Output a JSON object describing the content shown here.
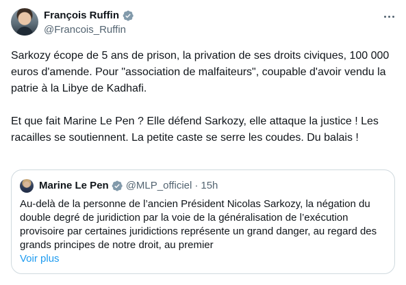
{
  "author": {
    "name": "François Ruffin",
    "handle": "@Francois_Ruffin",
    "verified": true,
    "verified_color": "#829aab"
  },
  "tweet": {
    "paragraphs": [
      "Sarkozy écope de 5 ans de prison, la privation de ses droits civiques, 100 000 euros d'amende. Pour \"association de malfaiteurs\", coupable d'avoir vendu la patrie à la Libye de Kadhafi.",
      "Et que fait Marine Le Pen ? Elle défend Sarkozy, elle attaque la justice ! Les racailles se soutiennent. La petite caste se serre les coudes. Du balais !"
    ]
  },
  "more_menu": {
    "icon": "more-horizontal-icon"
  },
  "quoted_tweet": {
    "name": "Marine Le Pen",
    "handle": "@MLP_officiel",
    "separator": "·",
    "time": "15h",
    "verified": true,
    "verified_color": "#829aab",
    "text": "Au-delà de la personne de l’ancien Président Nicolas Sarkozy, la négation  du double degré de juridiction par la voie de la généralisation de l’exécution provisoire par certaines juridictions représente un grand danger, au regard des grands principes de notre droit, au premier",
    "see_more_label": "Voir plus",
    "link_color": "#1d9bf0"
  }
}
